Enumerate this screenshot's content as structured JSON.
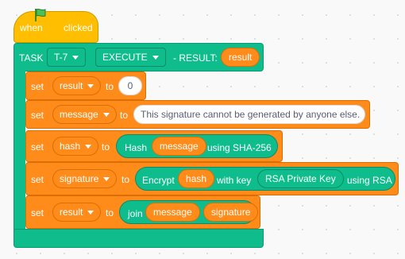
{
  "hat": {
    "when": "when",
    "clicked": "clicked"
  },
  "task": {
    "label": "TASK",
    "task_id": "T-7",
    "mode": "EXECUTE",
    "result_label": "- RESULT:",
    "result_var": "result"
  },
  "rows": [
    {
      "set": "set",
      "var": "result",
      "to": "to",
      "value": "0"
    },
    {
      "set": "set",
      "var": "message",
      "to": "to",
      "value": "This signature cannot be generated by anyone else."
    },
    {
      "set": "set",
      "var": "hash",
      "to": "to",
      "op": "Hash",
      "arg": "message",
      "suffix": "using SHA-256"
    },
    {
      "set": "set",
      "var": "signature",
      "to": "to",
      "op": "Encrypt",
      "arg": "hash",
      "mid": "with key",
      "key": "RSA Private Key",
      "suffix": "using RSA"
    },
    {
      "set": "set",
      "var": "result",
      "to": "to",
      "op": "join",
      "arg1": "message",
      "arg2": "signature"
    }
  ],
  "colors": {
    "events": "#ffbf00",
    "custom": "#0fbd8c",
    "variables": "#ff8c1a"
  }
}
